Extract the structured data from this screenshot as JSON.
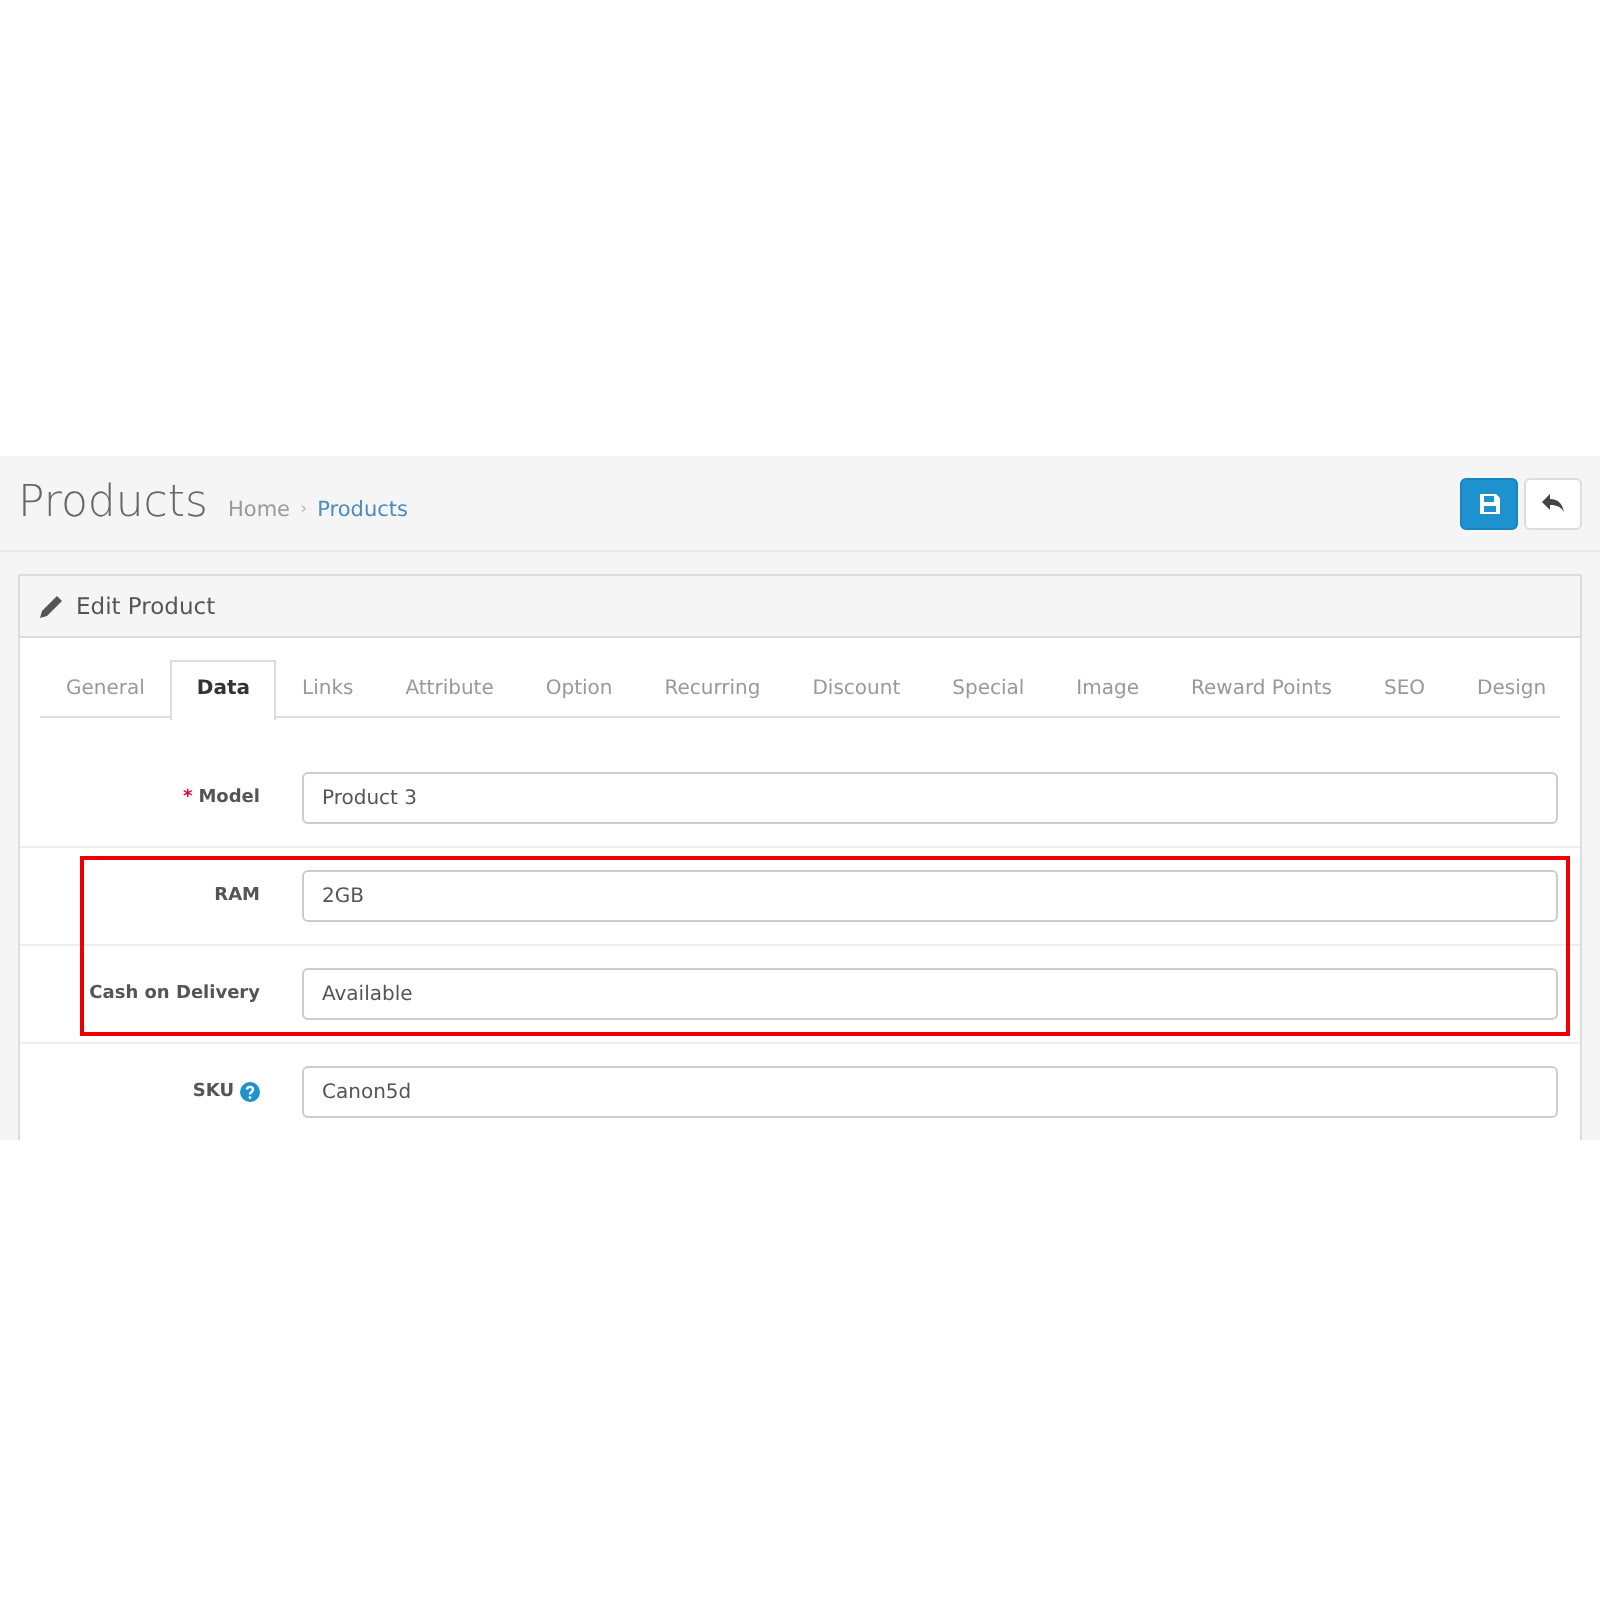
{
  "header": {
    "title": "Products",
    "breadcrumb": [
      {
        "label": "Home",
        "selected": false
      },
      {
        "label": "Products",
        "selected": true
      }
    ],
    "separator": "›"
  },
  "panel": {
    "title": "Edit Product"
  },
  "tabs": [
    {
      "label": "General",
      "selected": false
    },
    {
      "label": "Data",
      "selected": true
    },
    {
      "label": "Links",
      "selected": false
    },
    {
      "label": "Attribute",
      "selected": false
    },
    {
      "label": "Option",
      "selected": false
    },
    {
      "label": "Recurring",
      "selected": false
    },
    {
      "label": "Discount",
      "selected": false
    },
    {
      "label": "Special",
      "selected": false
    },
    {
      "label": "Image",
      "selected": false
    },
    {
      "label": "Reward Points",
      "selected": false
    },
    {
      "label": "SEO",
      "selected": false
    },
    {
      "label": "Design",
      "selected": false
    }
  ],
  "required_mark": "*",
  "fields": [
    {
      "label": "Model",
      "value": "Product 3",
      "required": true,
      "help": false,
      "highlighted": false
    },
    {
      "label": "RAM",
      "value": "2GB",
      "required": false,
      "help": false,
      "highlighted": true
    },
    {
      "label": "Cash on Delivery",
      "value": "Available",
      "required": false,
      "help": false,
      "highlighted": true
    },
    {
      "label": "SKU",
      "value": "Canon5d",
      "required": false,
      "help": true,
      "highlighted": false
    }
  ]
}
